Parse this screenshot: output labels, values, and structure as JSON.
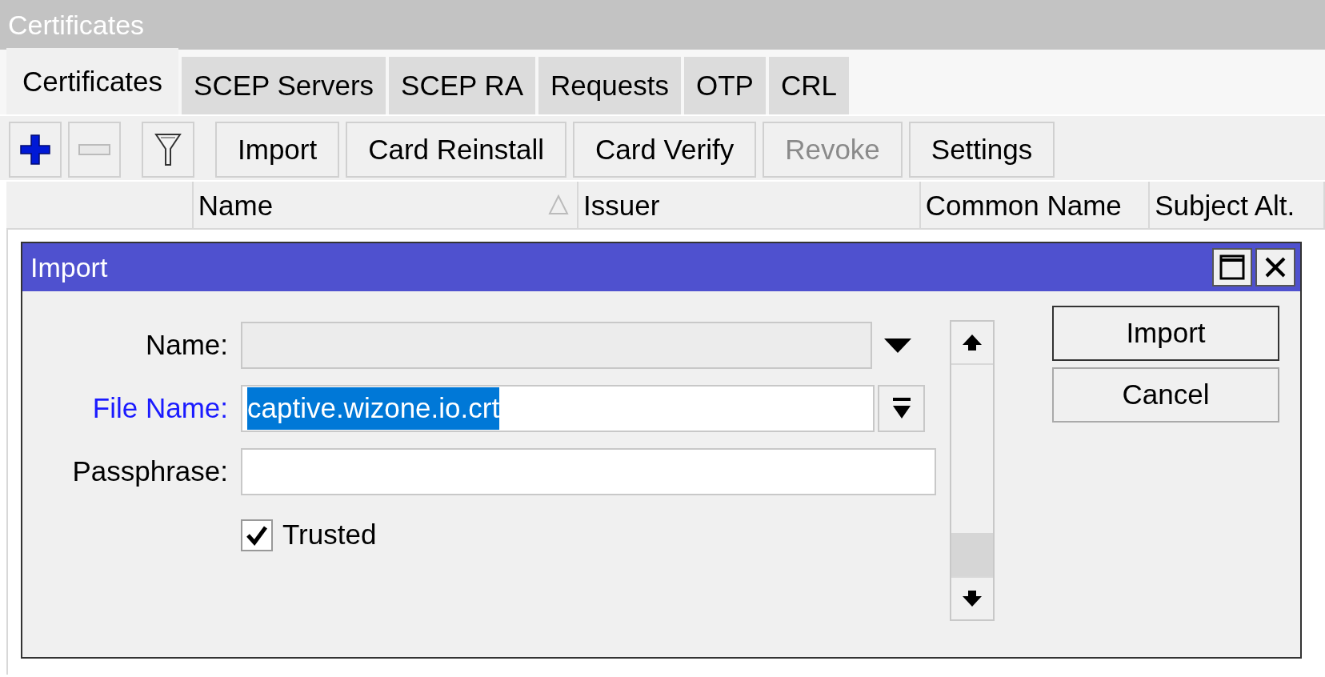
{
  "window": {
    "title": "Certificates"
  },
  "tabs": [
    {
      "label": "Certificates",
      "selected": true
    },
    {
      "label": "SCEP Servers",
      "selected": false
    },
    {
      "label": "SCEP RA",
      "selected": false
    },
    {
      "label": "Requests",
      "selected": false
    },
    {
      "label": "OTP",
      "selected": false
    },
    {
      "label": "CRL",
      "selected": false
    }
  ],
  "toolbar": [
    {
      "kind": "add",
      "disabled": false
    },
    {
      "kind": "remove",
      "disabled": false
    },
    {
      "kind": "filter",
      "disabled": false
    },
    {
      "kind": "text",
      "label": "Import",
      "disabled": false
    },
    {
      "kind": "text",
      "label": "Card Reinstall",
      "disabled": false
    },
    {
      "kind": "text",
      "label": "Card Verify",
      "disabled": false
    },
    {
      "kind": "text",
      "label": "Revoke",
      "disabled": true
    },
    {
      "kind": "text",
      "label": "Settings",
      "disabled": false
    }
  ],
  "table": {
    "columns": [
      {
        "sorted": false
      },
      {
        "label": "Name",
        "sorted": true
      },
      {
        "label": "Issuer",
        "sorted": false
      },
      {
        "label": "Common Name",
        "sorted": false
      },
      {
        "label": "Subject Alt.",
        "sorted": false
      }
    ]
  },
  "dialog": {
    "title": "Import",
    "fields": [
      {
        "kind": "combo",
        "label": "Name:",
        "modified": false
      },
      {
        "kind": "file",
        "label": "File Name:",
        "value": "captive.wizone.io.crt",
        "modified": true,
        "text_selected": true
      },
      {
        "kind": "text",
        "label": "Passphrase:",
        "modified": false
      }
    ],
    "checkbox": {
      "label": "Trusted",
      "checked": true
    },
    "buttons": [
      "Import",
      "Cancel"
    ]
  }
}
